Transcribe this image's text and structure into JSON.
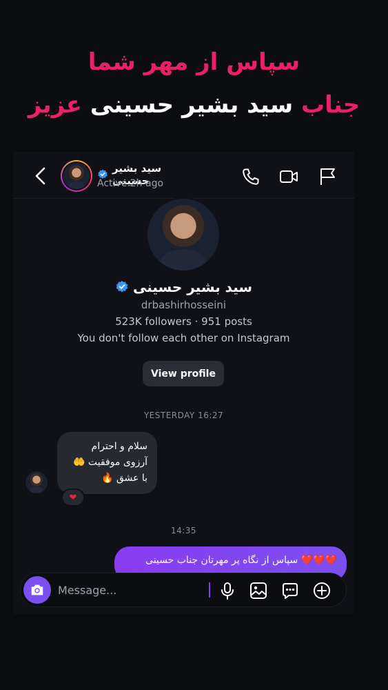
{
  "headline": {
    "line1": "سپاس از مهر شما",
    "line2_prefix": "جناب",
    "line2_name": "سید بشیر حسینی",
    "line2_suffix": "عزیز"
  },
  "chat_header": {
    "name": "سید بشیر حسینی",
    "status": "Active 2h ago"
  },
  "profile": {
    "name": "سید بشیر حسینی",
    "handle": "drbashirhosseini",
    "stats": "523K followers · 951 posts",
    "follow_note": "You don't follow each other on Instagram",
    "view_button": "View profile"
  },
  "thread": {
    "timestamp1": "YESTERDAY 16:27",
    "incoming": {
      "line1": "سلام و احترام",
      "line2": "آرزوی موفقیت 🤲",
      "line3": "با عشق 🔥",
      "reaction": "❤"
    },
    "timestamp2": "14:35",
    "outgoing": {
      "hearts": "❤️❤️❤️",
      "text": "سپاس از نگاه پر مهرتان جناب حسینی"
    }
  },
  "composer": {
    "placeholder": "Message..."
  },
  "colors": {
    "accent_pink": "#ec1f6a",
    "accent_purple": "#7b4ff0",
    "verified_blue": "#3897f0",
    "background": "#0b0c10"
  },
  "icons": [
    "back-icon",
    "verified-icon",
    "phone-icon",
    "video-icon",
    "flag-icon",
    "camera-icon",
    "microphone-icon",
    "gallery-icon",
    "sticker-icon",
    "plus-icon"
  ]
}
